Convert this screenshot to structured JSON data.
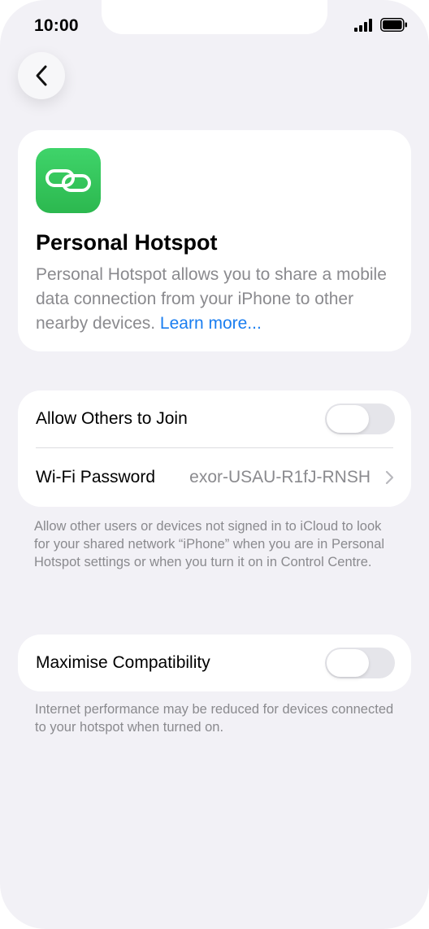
{
  "status_bar": {
    "time": "10:00"
  },
  "nav": {
    "back_icon": "chevron-left-icon"
  },
  "hero": {
    "icon": "link-chain-icon",
    "icon_color": "#34c759",
    "title": "Personal Hotspot",
    "description": "Personal Hotspot allows you to share a mobile data connection from your iPhone to other nearby devices. ",
    "learn_more": "Learn more..."
  },
  "settings": {
    "allow_others": {
      "label": "Allow Others to Join",
      "enabled": false
    },
    "wifi_password": {
      "label": "Wi-Fi Password",
      "value": "exor-USAU-R1fJ-RNSH"
    },
    "footnote": "Allow other users or devices not signed in to iCloud to look for your shared network “iPhone” when you are in Personal Hotspot settings or when you turn it on in Control Centre."
  },
  "compatibility": {
    "label": "Maximise Compatibility",
    "enabled": false,
    "footnote": "Internet performance may be reduced for devices connected to your hotspot when turned on."
  },
  "colors": {
    "background": "#f2f1f6",
    "link": "#1a7ef0",
    "toggle_off": "#e5e5ea"
  }
}
